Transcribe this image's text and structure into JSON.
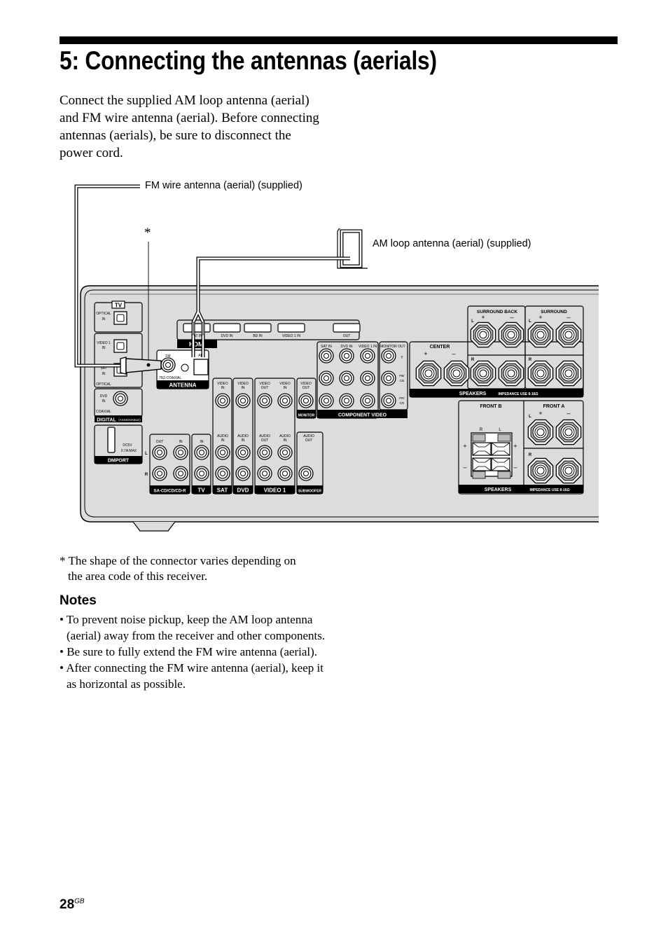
{
  "page": {
    "title": "5: Connecting the antennas (aerials)",
    "intro": "Connect the supplied AM loop antenna (aerial) and FM wire antenna (aerial). Before connecting antennas (aerials), be sure to disconnect the power cord.",
    "page_number": "28",
    "page_suffix": "GB"
  },
  "diagram": {
    "fm_label": "FM wire antenna (aerial) (supplied)",
    "am_label": "AM loop antenna (aerial) (supplied)",
    "asterisk": "*",
    "panel": {
      "tv": "TV",
      "optical_in": "OPTICAL",
      "in": "IN",
      "video1_in_a": "VIDEO 1",
      "sat_in_a": "SAT",
      "optical": "OPTICAL",
      "dvd": "DVD",
      "coaxial": "COAXIAL",
      "digital": "DIGITAL",
      "assignable": "(ASSIGNABLE)",
      "dc": "DC5V",
      "ma": "0.7A  MAX",
      "dmport": "DMPORT",
      "hdmi": "HDMI",
      "hdmi_ports": [
        "SAT IN",
        "DVD IN",
        "BD IN",
        "VIDEO 1 IN",
        "OUT"
      ],
      "fm": "FM",
      "coax75": "75Ω COAXIAL",
      "am": "AM",
      "antenna": "ANTENNA",
      "video": "VIDEO",
      "audio": "AUDIO",
      "out": "OUT",
      "monitor": "MONITOR",
      "subwoofer": "SUBWOOFER",
      "comp_cols": [
        "SAT IN",
        "DVD IN",
        "VIDEO 1 IN"
      ],
      "monitor_out": "MONITOR OUT",
      "y": "Y",
      "pb": "PB/",
      "cb": "CB",
      "pr": "PR/",
      "cr": "CR",
      "component_video": "COMPONENT VIDEO",
      "l": "L",
      "r": "R",
      "plus": "+",
      "minus": "–",
      "sacd": "SA-CD/CD/CD-R",
      "sat": "SAT",
      "video1": "VIDEO 1",
      "center": "CENTER",
      "surround_back": "SURROUND BACK",
      "surround": "SURROUND",
      "front_b": "FRONT B",
      "front_a": "FRONT A",
      "speakers": "SPEAKERS",
      "impedance": "IMPEDANCE USE 8-16Ω"
    }
  },
  "footnote": {
    "line1": "* The shape of the connector varies depending on",
    "line2": "the area code of this receiver."
  },
  "notes": {
    "heading": "Notes",
    "items": [
      "• To prevent noise pickup, keep the AM loop antenna (aerial) away from the receiver and other components.",
      "• Be sure to fully extend the FM wire antenna (aerial).",
      "• After connecting the FM wire antenna (aerial), keep it as horizontal as possible."
    ]
  }
}
